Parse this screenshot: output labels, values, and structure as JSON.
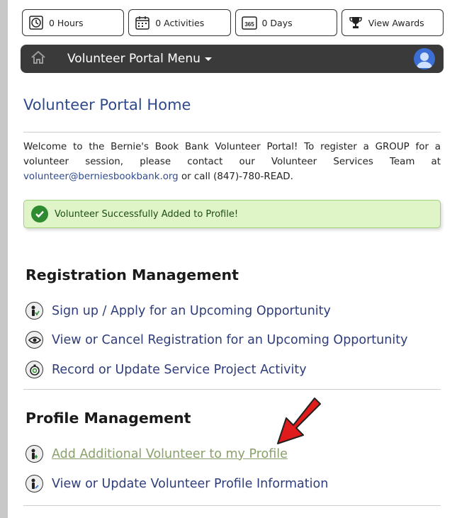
{
  "stats": {
    "hours": "0 Hours",
    "activities": "0 Activities",
    "days": "0 Days",
    "days_icon_text": "365",
    "awards": "View Awards"
  },
  "nav": {
    "title": "Volunteer Portal Menu",
    "colors": {
      "bar": "#3a3a3a",
      "avatar": "#3b6fd6"
    }
  },
  "page": {
    "title": "Volunteer Portal Home",
    "welcome_text": "Welcome to the Bernie's Book Bank Volunteer Portal! To register a GROUP for a volunteer session, please contact our Volunteer Services Team at",
    "email": "volunteer@berniesbookbank.org",
    "call_text": "or call (847)-780-READ.",
    "alert": "Volunteer Successfully Added to Profile!"
  },
  "registration": {
    "heading": "Registration Management",
    "items": [
      {
        "label": "Sign up / Apply for an Upcoming Opportunity",
        "icon": "person-icon"
      },
      {
        "label": "View or Cancel Registration for an Upcoming Opportunity",
        "icon": "eye-icon"
      },
      {
        "label": "Record or Update Service Project Activity",
        "icon": "stopwatch-icon"
      }
    ]
  },
  "profile": {
    "heading": "Profile Management",
    "items": [
      {
        "label": "Add Additional Volunteer to my Profile",
        "icon": "person-icon"
      },
      {
        "label": "View or Update Volunteer Profile Information",
        "icon": "person-icon"
      }
    ]
  }
}
